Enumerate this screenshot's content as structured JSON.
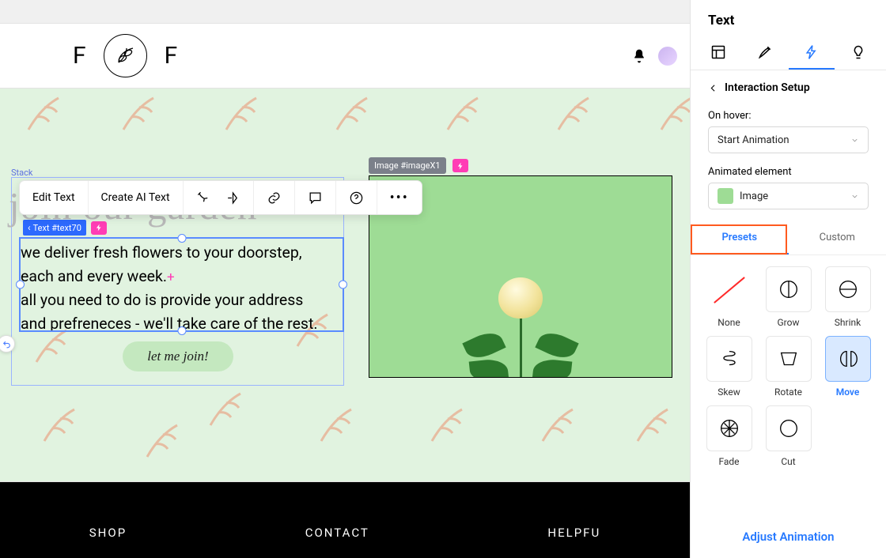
{
  "ribbon": {
    "letter": "F"
  },
  "canvas": {
    "stack_label": "Stack",
    "image_tag": "Image #imageX1",
    "text_tag": "Text #text70",
    "headline": "join our garden",
    "body_line1": "we deliver fresh flowers to your doorstep,",
    "body_line2": "each and every week.",
    "body_line3": "all you need to do is provide your address",
    "body_line4": "and prefreneces - we'll take care of the rest.",
    "cta": "let me join!"
  },
  "popup": {
    "edit_text": "Edit Text",
    "create_ai": "Create AI Text"
  },
  "footer": {
    "shop": "SHOP",
    "contact": "CONTACT",
    "helpful": "HELPFU"
  },
  "sidebar": {
    "title": "Text",
    "interaction_setup": "Interaction Setup",
    "on_hover_label": "On hover:",
    "on_hover_value": "Start Animation",
    "anim_elem_label": "Animated element",
    "anim_elem_value": "Image",
    "tab_presets": "Presets",
    "tab_custom": "Custom",
    "adjust": "Adjust Animation",
    "presets": {
      "none": "None",
      "grow": "Grow",
      "shrink": "Shrink",
      "skew": "Skew",
      "rotate": "Rotate",
      "move": "Move",
      "fade": "Fade",
      "cut": "Cut"
    }
  }
}
